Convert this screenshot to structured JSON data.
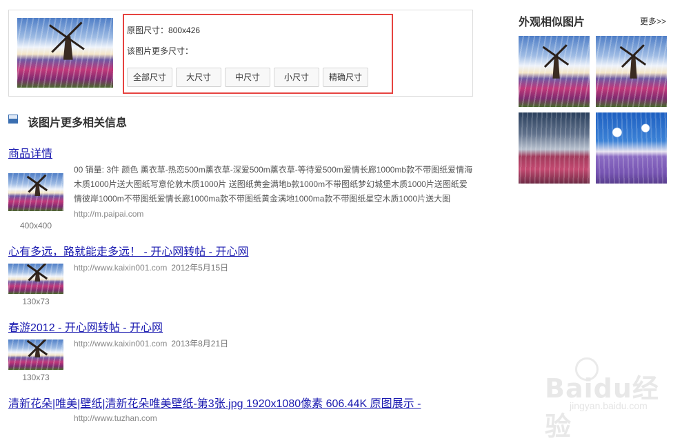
{
  "info": {
    "orig_size_label": "原图尺寸：",
    "orig_size_value": "800x426",
    "more_sizes_label": "该图片更多尺寸：",
    "size_buttons": [
      "全部尺寸",
      "大尺寸",
      "中尺寸",
      "小尺寸",
      "精确尺寸"
    ]
  },
  "section": {
    "title": "该图片更多相关信息"
  },
  "results": [
    {
      "title": "商品详情",
      "desc": "00 销量: 3件 颜色 薰衣草-热恋500m薰衣草-深爱500m薰衣草-等待爱500m爱情长廊1000mb款不带图纸爱情海木质1000片送大图纸写意伦敦木质1000片 送图纸黄金满地b款1000m不带图纸梦幻城堡木质1000片送图纸爱情彼岸1000m不带图纸爱情长廊1000ma款不带图纸黄金满地1000ma款不带图纸星空木质1000片送大图",
      "url": "http://m.paipai.com",
      "date": "",
      "size": "400x400"
    },
    {
      "title": "心有多远，路就能走多远！ - 开心网转帖 - 开心网",
      "desc": "",
      "url": "http://www.kaixin001.com",
      "date": "2012年5月15日",
      "size": "130x73"
    },
    {
      "title": "春游2012 - 开心网转帖 - 开心网",
      "desc": "",
      "url": "http://www.kaixin001.com",
      "date": "2013年8月21日",
      "size": "130x73"
    },
    {
      "title": "清新花朵|唯美|壁纸|清新花朵唯美壁纸-第3张.jpg 1920x1080像素 606.44K 原图展示 -",
      "desc": "",
      "url": "http://www.tuzhan.com",
      "date": "",
      "size": ""
    }
  ],
  "similar": {
    "title": "外观相似图片",
    "more": "更多>>"
  },
  "watermark": {
    "logo": "Baidu经验",
    "sub": "jingyan.baidu.com"
  }
}
